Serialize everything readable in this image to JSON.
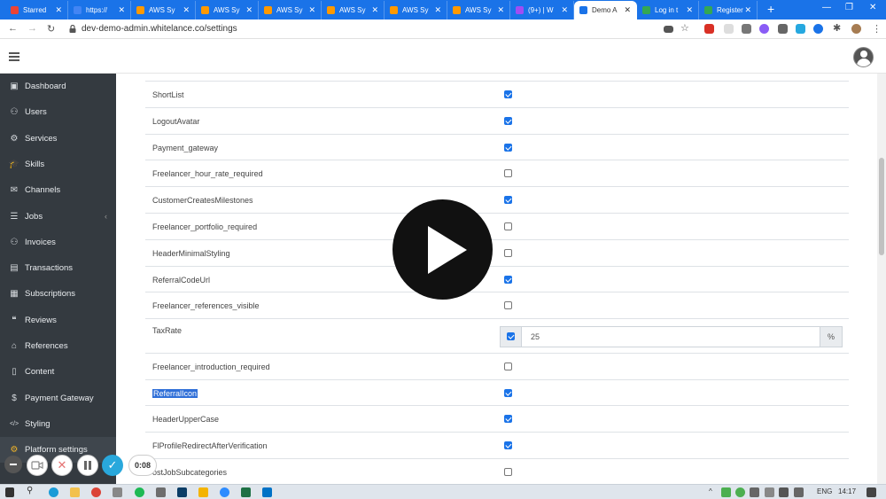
{
  "browser": {
    "tabs": [
      {
        "label": "Starred",
        "favicon_color": "#ea4335",
        "active": false
      },
      {
        "label": "https://",
        "favicon_color": "#4285f4",
        "active": false
      },
      {
        "label": "AWS Sy",
        "favicon_color": "#ff9900",
        "active": false
      },
      {
        "label": "AWS Sy",
        "favicon_color": "#ff9900",
        "active": false
      },
      {
        "label": "AWS Sy",
        "favicon_color": "#ff9900",
        "active": false
      },
      {
        "label": "AWS Sy",
        "favicon_color": "#ff9900",
        "active": false
      },
      {
        "label": "AWS Sy",
        "favicon_color": "#ff9900",
        "active": false
      },
      {
        "label": "AWS Sy",
        "favicon_color": "#ff9900",
        "active": false
      },
      {
        "label": "(9+) | W",
        "favicon_color": "#a04df3",
        "active": false
      },
      {
        "label": "Demo A",
        "favicon_color": "#1a73e8",
        "active": true
      },
      {
        "label": "Log in t",
        "favicon_color": "#34a853",
        "active": false
      },
      {
        "label": "Register",
        "favicon_color": "#34a853",
        "active": false
      }
    ],
    "url": "dev-demo-admin.whitelance.co/settings"
  },
  "sidebar": {
    "items": [
      {
        "label": "Dashboard",
        "icon": "dashboard-icon"
      },
      {
        "label": "Users",
        "icon": "user-icon"
      },
      {
        "label": "Services",
        "icon": "gear-icon"
      },
      {
        "label": "Skills",
        "icon": "graduation-cap-icon"
      },
      {
        "label": "Channels",
        "icon": "envelope-icon"
      },
      {
        "label": "Jobs",
        "icon": "list-icon",
        "has_submenu": true
      },
      {
        "label": "Invoices",
        "icon": "invoice-user-icon"
      },
      {
        "label": "Transactions",
        "icon": "money-icon"
      },
      {
        "label": "Subscriptions",
        "icon": "id-card-icon"
      },
      {
        "label": "Reviews",
        "icon": "comments-icon"
      },
      {
        "label": "References",
        "icon": "bank-icon"
      },
      {
        "label": "Content",
        "icon": "file-icon"
      },
      {
        "label": "Payment Gateway",
        "icon": "dollar-icon"
      },
      {
        "label": "Styling",
        "icon": "code-icon"
      },
      {
        "label": "Platform settings",
        "icon": "cogs-icon",
        "active": true
      }
    ]
  },
  "settings": [
    {
      "label": "ShortList",
      "checked": true
    },
    {
      "label": "LogoutAvatar",
      "checked": true
    },
    {
      "label": "Payment_gateway",
      "checked": true
    },
    {
      "label": "Freelancer_hour_rate_required",
      "checked": false
    },
    {
      "label": "CustomerCreatesMilestones",
      "checked": true
    },
    {
      "label": "Freelancer_portfolio_required",
      "checked": false
    },
    {
      "label": "HeaderMinimalStyling",
      "checked": false
    },
    {
      "label": "ReferralCodeUrl",
      "checked": true
    },
    {
      "label": "Freelancer_references_visible",
      "checked": false
    },
    {
      "label": "TaxRate",
      "checked": true,
      "value": "25",
      "suffix": "%"
    },
    {
      "label": "Freelancer_introduction_required",
      "checked": false
    },
    {
      "label": "ReferralIcon",
      "checked": true,
      "highlighted": true
    },
    {
      "label": "HeaderUpperCase",
      "checked": true
    },
    {
      "label": "FlProfileRedirectAfterVerification",
      "checked": true
    },
    {
      "label": "ostJobSubcategories",
      "checked": false
    }
  ],
  "recorder": {
    "time": "0:08"
  },
  "taskbar": {
    "lang": "ENG",
    "time": "14:17"
  },
  "colors": {
    "sidebar_bg": "#343a40",
    "accent": "#1a73e8",
    "tabbar": "#1a73e8"
  }
}
